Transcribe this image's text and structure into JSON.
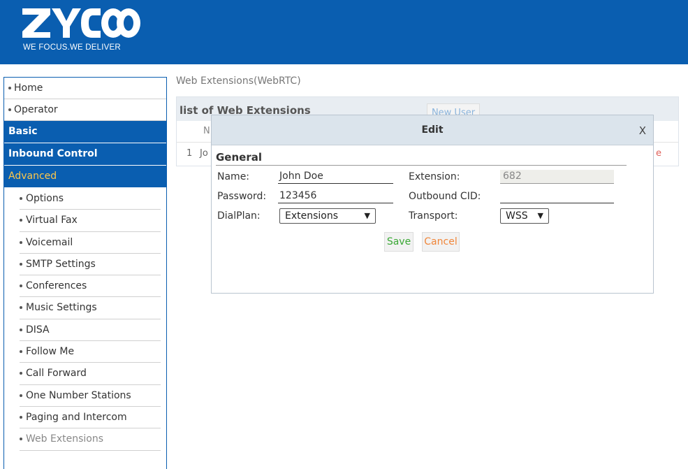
{
  "brand": {
    "tagline": "WE FOCUS.WE DELIVER",
    "logo_text": "ZYCOO",
    "header_color": "#0a5eb0"
  },
  "sidebar": {
    "top_items": [
      {
        "label": "Home"
      },
      {
        "label": "Operator"
      }
    ],
    "categories": [
      {
        "label": "Basic"
      },
      {
        "label": "Inbound Control"
      },
      {
        "label": "Advanced"
      }
    ],
    "sub_items": [
      {
        "label": "Options"
      },
      {
        "label": "Virtual Fax"
      },
      {
        "label": "Voicemail"
      },
      {
        "label": "SMTP Settings"
      },
      {
        "label": "Conferences"
      },
      {
        "label": "Music Settings"
      },
      {
        "label": "DISA"
      },
      {
        "label": "Follow Me"
      },
      {
        "label": "Call Forward"
      },
      {
        "label": "One Number Stations"
      },
      {
        "label": "Paging and Intercom"
      },
      {
        "label": "Web Extensions"
      }
    ]
  },
  "breadcrumb": "Web Extensions(WebRTC)",
  "list": {
    "title": "list of Web Extensions",
    "new_user_label": "New User",
    "column_partial": "N",
    "row": {
      "index": "1",
      "name_partial": "Jo",
      "action_partial": "e"
    }
  },
  "dialog": {
    "title": "Edit",
    "close": "X",
    "section": "General",
    "name_label": "Name:",
    "name_value": "John Doe",
    "password_label": "Password:",
    "password_value": "123456",
    "dialplan_label": "DialPlan:",
    "dialplan_value": "Extensions",
    "extension_label": "Extension:",
    "extension_value": "682",
    "outbound_label": "Outbound CID:",
    "outbound_value": "",
    "transport_label": "Transport:",
    "transport_value": "WSS",
    "save_label": "Save",
    "cancel_label": "Cancel",
    "save_color": "#3aa835",
    "cancel_color": "#f0863a"
  }
}
